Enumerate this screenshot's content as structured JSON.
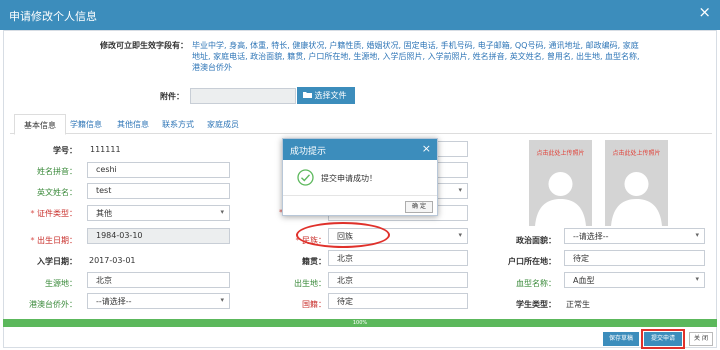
{
  "window": {
    "title": "申请修改个人信息",
    "close_label": "×"
  },
  "editable_fields": {
    "label": "修改可立即生效字段有：",
    "text": "毕业中学, 身高, 体重, 特长, 健康状况, 户籍性质, 婚姻状况, 固定电话, 手机号码, 电子邮箱, QQ号码, 通讯地址, 邮政编码, 家庭地址, 家庭电话, 政治面貌, 籍贯, 户口所在地, 生源地, 入学后照片, 入学前照片, 姓名拼音, 英文姓名, 曾用名, 出生地, 血型名称, 港澳台侨外"
  },
  "attachment": {
    "label": "附件：",
    "button": "选择文件"
  },
  "tabs": [
    "基本信息",
    "学籍信息",
    "其他信息",
    "联系方式",
    "家庭成员"
  ],
  "form": {
    "student_no": {
      "label": "学号：",
      "value": "111111"
    },
    "name_pinyin": {
      "label": "姓名拼音：",
      "value": "ceshi"
    },
    "english_name": {
      "label": "英文姓名：",
      "value": "test"
    },
    "id_type": {
      "label": "证件类型：",
      "value": "其他"
    },
    "birth_date": {
      "label": "出生日期：",
      "value": "1984-03-10"
    },
    "nation": {
      "label": "民族：",
      "value": "回族"
    },
    "political": {
      "label": "政治面貌：",
      "value": "--请选择--"
    },
    "enroll_date": {
      "label": "入学日期：",
      "value": "2017-03-01"
    },
    "native_place": {
      "label": "籍贯：",
      "value": "北京"
    },
    "hukou": {
      "label": "户口所在地：",
      "value": "待定"
    },
    "origin": {
      "label": "生源地：",
      "value": "北京"
    },
    "birth_place": {
      "label": "出生地：",
      "value": "北京"
    },
    "blood_type": {
      "label": "血型名称：",
      "value": "A血型"
    },
    "overseas": {
      "label": "港澳台侨外：",
      "value": "--请选择--"
    },
    "nationality": {
      "label": "国籍：",
      "value": "待定"
    },
    "student_type": {
      "label": "学生类型：",
      "value": "正常生"
    }
  },
  "photos": {
    "caption": "点击此处上传照片"
  },
  "modal": {
    "title": "成功提示",
    "message": "提交申请成功！",
    "ok": "确 定",
    "close": "×"
  },
  "progress": {
    "label": "100%",
    "value": 100
  },
  "footer": {
    "save_draft": "保存草稿",
    "submit": "提交申请",
    "close": "关 闭"
  },
  "colors": {
    "primary": "#3c8dbc",
    "success": "#5cb85c",
    "annotation": "#e0312b"
  }
}
